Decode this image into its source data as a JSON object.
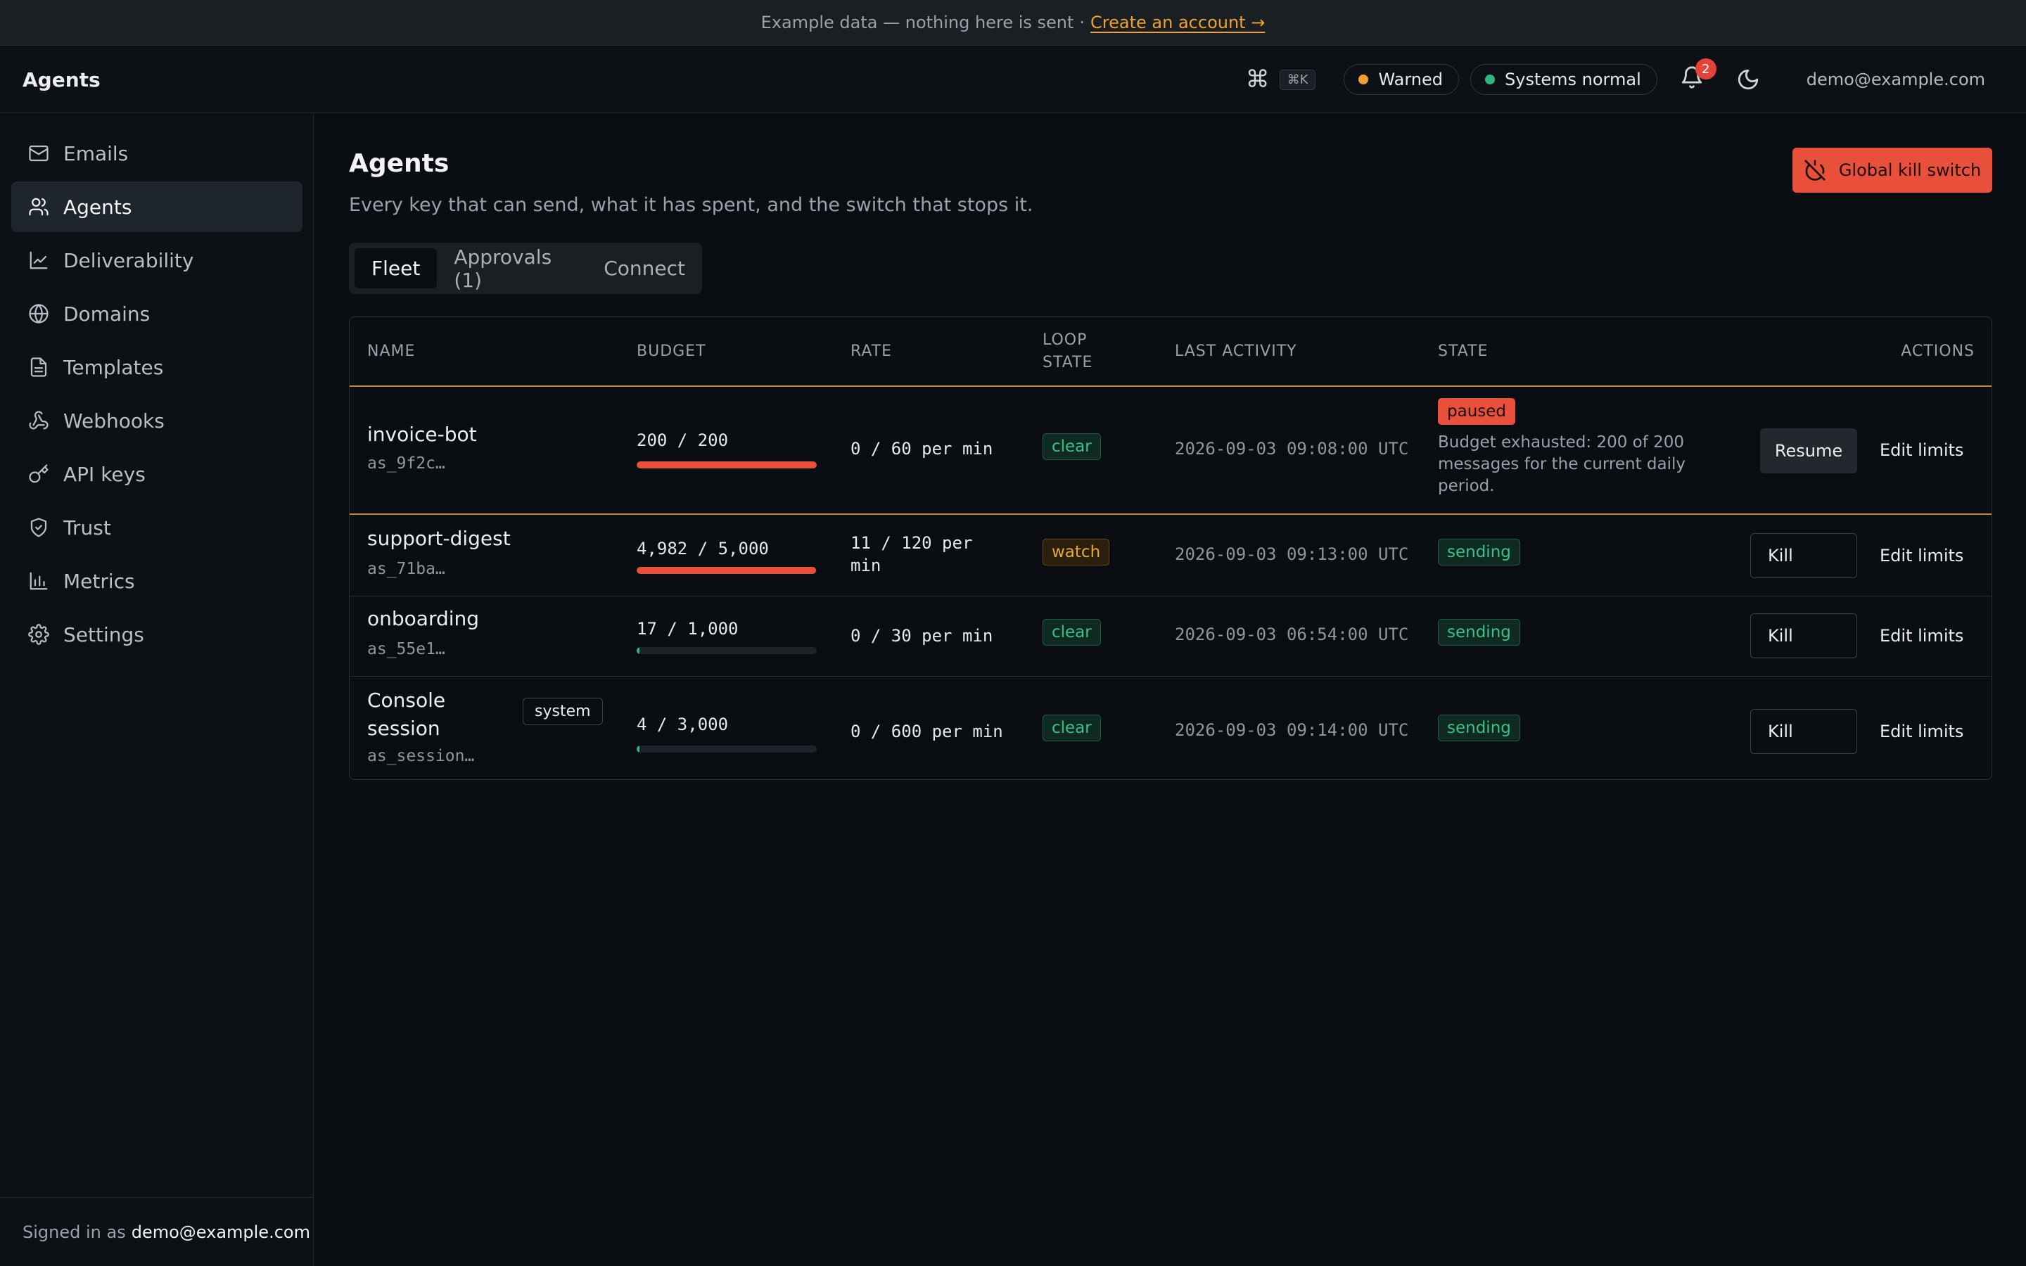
{
  "banner": {
    "text": "Example data — nothing here is sent",
    "separator": "·",
    "link": "Create an account →"
  },
  "header": {
    "title": "Agents",
    "shortcut_icon": "command-icon",
    "shortcut_key": "⌘K",
    "status_warned": "Warned",
    "status_systems": "Systems normal",
    "notification_count": "2",
    "user_email": "demo@example.com"
  },
  "colors": {
    "accent_red": "#e8503c",
    "warn": "#f0a030",
    "ok": "#2fb57f"
  },
  "sidebar": {
    "items": [
      {
        "label": "Emails",
        "icon": "mail-icon"
      },
      {
        "label": "Agents",
        "icon": "users-icon",
        "active": true
      },
      {
        "label": "Deliverability",
        "icon": "chart-line-icon"
      },
      {
        "label": "Domains",
        "icon": "globe-icon"
      },
      {
        "label": "Templates",
        "icon": "file-icon"
      },
      {
        "label": "Webhooks",
        "icon": "webhook-icon"
      },
      {
        "label": "API keys",
        "icon": "key-icon"
      },
      {
        "label": "Trust",
        "icon": "shield-icon"
      },
      {
        "label": "Metrics",
        "icon": "bar-chart-icon"
      },
      {
        "label": "Settings",
        "icon": "gear-icon"
      }
    ],
    "footer_prefix": "Signed in as",
    "footer_email": "demo@example.com"
  },
  "main": {
    "title": "Agents",
    "subtitle": "Every key that can send, what it has spent, and the switch that stops it.",
    "kill_switch_label": "Global kill switch",
    "tabs": [
      {
        "label": "Fleet",
        "active": true
      },
      {
        "label": "Approvals (1)"
      },
      {
        "label": "Connect"
      }
    ],
    "table": {
      "headers": {
        "name": "NAME",
        "budget": "BUDGET",
        "rate": "RATE",
        "loop_state_1": "LOOP",
        "loop_state_2": "STATE",
        "last_activity": "LAST ACTIVITY",
        "state": "STATE",
        "actions": "ACTIONS"
      },
      "rows": [
        {
          "name": "invoice-bot",
          "key": "as_9f2c…",
          "budget": "200 / 200",
          "budget_fraction": 1.0,
          "rate": "0 / 60 per min",
          "loop_state": "clear",
          "last_activity": "2026-09-03 09:08:00 UTC",
          "state": "paused",
          "state_note": "Budget exhausted: 200 of 200 messages for the current daily period.",
          "primary_action": "Resume",
          "secondary_action": "Edit limits"
        },
        {
          "name": "support-digest",
          "key": "as_71ba…",
          "budget": "4,982 / 5,000",
          "budget_fraction": 0.996,
          "rate_line1": "11 / 120 per",
          "rate_line2": "min",
          "loop_state": "watch",
          "last_activity": "2026-09-03 09:13:00 UTC",
          "state": "sending",
          "primary_action": "Kill",
          "secondary_action": "Edit limits"
        },
        {
          "name": "onboarding",
          "key": "as_55e1…",
          "budget": "17 / 1,000",
          "budget_fraction": 0.017,
          "rate": "0 / 30 per min",
          "loop_state": "clear",
          "last_activity": "2026-09-03 06:54:00 UTC",
          "state": "sending",
          "primary_action": "Kill",
          "secondary_action": "Edit limits"
        },
        {
          "name_line1": "Console",
          "name_line2": "session",
          "tag": "system",
          "key": "as_session…",
          "budget": "4 / 3,000",
          "budget_fraction": 0.0013,
          "rate": "0 / 600 per min",
          "loop_state": "clear",
          "last_activity": "2026-09-03 09:14:00 UTC",
          "state": "sending",
          "primary_action": "Kill",
          "secondary_action": "Edit limits"
        }
      ]
    }
  }
}
